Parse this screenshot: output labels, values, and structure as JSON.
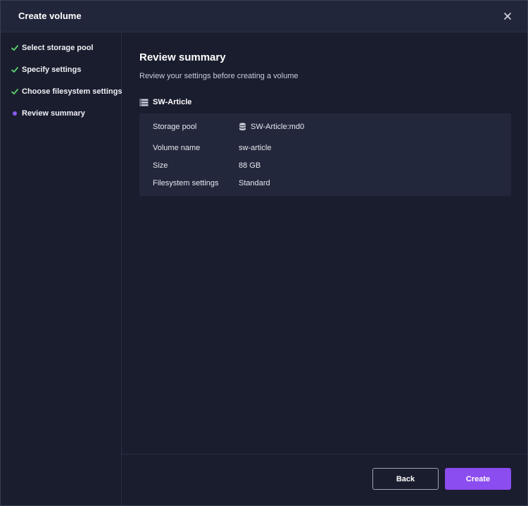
{
  "dialog": {
    "title": "Create volume",
    "close_icon": "close-icon"
  },
  "steps": [
    {
      "label": "Select storage pool",
      "state": "complete",
      "icon": "check-icon"
    },
    {
      "label": "Specify settings",
      "state": "complete",
      "icon": "check-icon"
    },
    {
      "label": "Choose filesystem settings",
      "state": "complete",
      "icon": "check-icon"
    },
    {
      "label": "Review summary",
      "state": "current",
      "icon": "current-step-dot"
    }
  ],
  "main": {
    "heading": "Review summary",
    "subheading": "Review your settings before creating a volume",
    "volume_name_title": "SW-Article",
    "volume_icon": "volume-icon",
    "summary": [
      {
        "key": "Storage pool",
        "value": "SW-Article:md0",
        "icon": "database-icon"
      },
      {
        "key": "Volume name",
        "value": "sw-article"
      },
      {
        "key": "Size",
        "value": "88 GB"
      },
      {
        "key": "Filesystem settings",
        "value": "Standard"
      }
    ]
  },
  "footer": {
    "back_label": "Back",
    "create_label": "Create"
  },
  "colors": {
    "background": "#1a1d2e",
    "titlebar": "#22263a",
    "panel": "#23273b",
    "accent": "#8b4cf0",
    "check": "#5ad16b"
  }
}
